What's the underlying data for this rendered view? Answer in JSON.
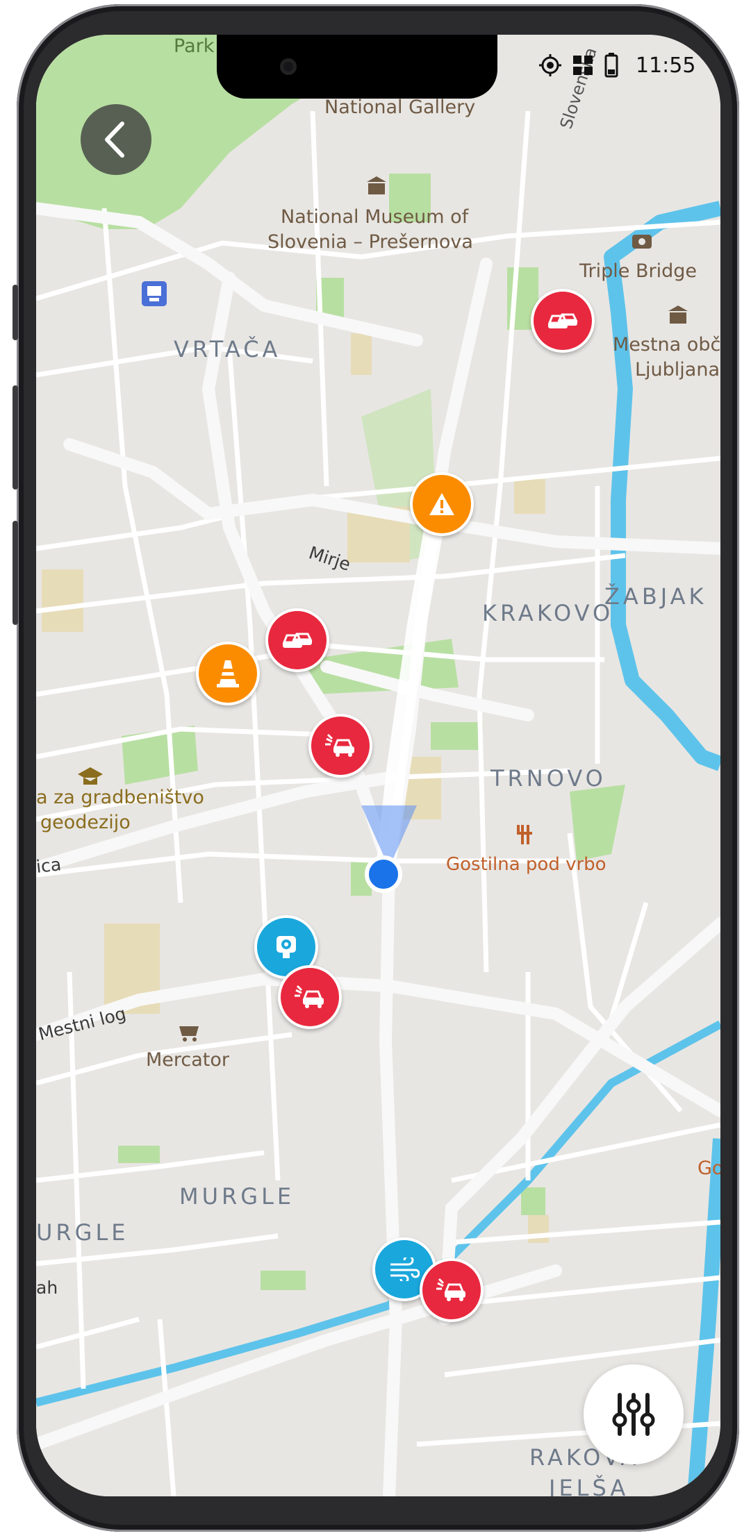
{
  "status_bar": {
    "time": "11:55",
    "icons": [
      "location-icon",
      "data-icon",
      "battery-icon"
    ]
  },
  "map": {
    "labels": {
      "park": "Park Ti",
      "national_gallery": "National Gallery",
      "slovenska": "Slovenska",
      "museum_line1": "National Museum of",
      "museum_line2": "Slovenia – Prešernova",
      "triple_bridge": "Triple Bridge",
      "mestna_line1": "Mestna obči",
      "mestna_line2": "Ljubljana",
      "vrtaca": "VRTAČA",
      "mirje": "Mirje",
      "krakovo": "KRAKOVO",
      "zabjak": "ŽABJAK",
      "trnovo": "TRNOVO",
      "gostilna": "Gostilna pod vrbo",
      "school_line1": "a za gradbeništvo",
      "school_line2": "geodezijo",
      "ica": "ica",
      "mestni_log": "Mestni log",
      "mercator": "Mercator",
      "murgle": "MURGLE",
      "urgle": "URGLE",
      "ah": "ah",
      "gos": "Gos",
      "rakova_line1": "RAKOVA",
      "rakova_line2": "JELŠA"
    },
    "colors": {
      "incident_red": "#e8283e",
      "warning_orange": "#fb8c00",
      "info_blue": "#1aa7dc",
      "river": "#5ec3ea",
      "park_green": "#b8dfa2",
      "current_location": "#1a73e8"
    }
  },
  "markers": [
    {
      "type": "traffic-jam",
      "icon": "traffic-jam-icon"
    },
    {
      "type": "hazard-warning",
      "icon": "warning-icon"
    },
    {
      "type": "traffic-jam",
      "icon": "traffic-jam-icon"
    },
    {
      "type": "roadworks",
      "icon": "traffic-cone-icon"
    },
    {
      "type": "accident",
      "icon": "car-crash-icon"
    },
    {
      "type": "speed-camera",
      "icon": "speed-camera-icon"
    },
    {
      "type": "accident",
      "icon": "car-crash-icon"
    },
    {
      "type": "wind",
      "icon": "wind-icon"
    },
    {
      "type": "accident",
      "icon": "car-crash-icon"
    }
  ],
  "controls": {
    "back": "chevron-left-icon",
    "filter": "sliders-icon"
  }
}
